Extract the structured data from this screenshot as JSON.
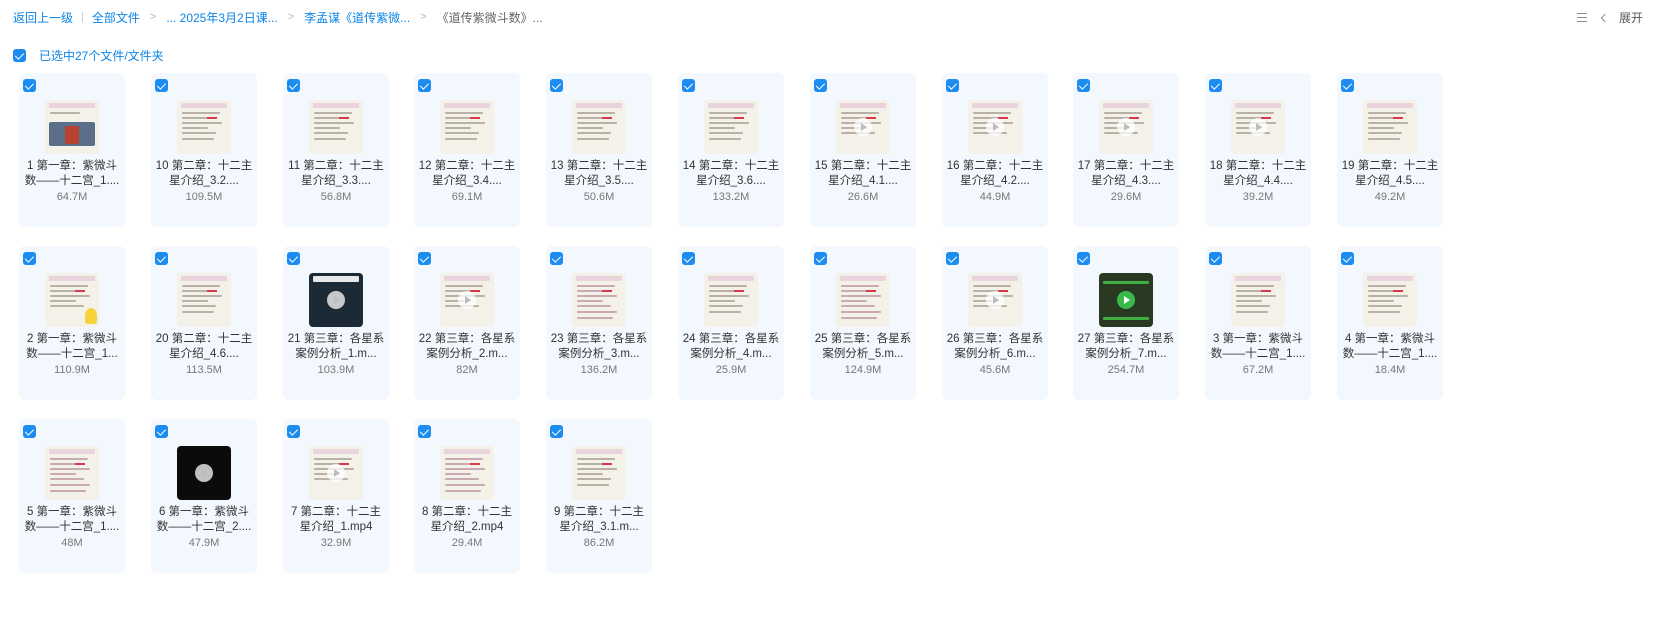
{
  "breadcrumb": {
    "back": "返回上一级",
    "all_files": "全部文件",
    "path1": "... 2025年3月2日课...",
    "path2": "李孟谋《道传紫微...",
    "current": "《道传紫微斗数》..."
  },
  "toolbar": {
    "expand": "展开"
  },
  "selection": {
    "label": "已选中27个文件/文件夹"
  },
  "files": [
    {
      "name": "1 第一章：紫微斗数——十二宫_1....",
      "size": "64.7M",
      "thumb": "photo"
    },
    {
      "name": "10 第二章：十二主星介绍_3.2....",
      "size": "109.5M",
      "thumb": "slide"
    },
    {
      "name": "11 第二章：十二主星介绍_3.3....",
      "size": "56.8M",
      "thumb": "slide"
    },
    {
      "name": "12 第二章：十二主星介绍_3.4....",
      "size": "69.1M",
      "thumb": "slide"
    },
    {
      "name": "13 第二章：十二主星介绍_3.5....",
      "size": "50.6M",
      "thumb": "slide"
    },
    {
      "name": "14 第二章：十二主星介绍_3.6....",
      "size": "133.2M",
      "thumb": "slide"
    },
    {
      "name": "15 第二章：十二主星介绍_4.1....",
      "size": "26.6M",
      "thumb": "slide-play"
    },
    {
      "name": "16 第二章：十二主星介绍_4.2....",
      "size": "44.9M",
      "thumb": "slide-play"
    },
    {
      "name": "17 第二章：十二主星介绍_4.3....",
      "size": "29.6M",
      "thumb": "slide-play"
    },
    {
      "name": "18 第二章：十二主星介绍_4.4....",
      "size": "39.2M",
      "thumb": "slide-play"
    },
    {
      "name": "19 第二章：十二主星介绍_4.5....",
      "size": "49.2M",
      "thumb": "slide"
    },
    {
      "name": "2 第一章：紫微斗数——十二宫_1...",
      "size": "110.9M",
      "thumb": "mascot"
    },
    {
      "name": "20 第二章：十二主星介绍_4.6....",
      "size": "113.5M",
      "thumb": "slide"
    },
    {
      "name": "21 第三章：各星系案例分析_1.m...",
      "size": "103.9M",
      "thumb": "stage"
    },
    {
      "name": "22 第三章：各星系案例分析_2.m...",
      "size": "82M",
      "thumb": "slide-play"
    },
    {
      "name": "23 第三章：各星系案例分析_3.m...",
      "size": "136.2M",
      "thumb": "table"
    },
    {
      "name": "24 第三章：各星系案例分析_4.m...",
      "size": "25.9M",
      "thumb": "slide"
    },
    {
      "name": "25 第三章：各星系案例分析_5.m...",
      "size": "124.9M",
      "thumb": "table"
    },
    {
      "name": "26 第三章：各星系案例分析_6.m...",
      "size": "45.6M",
      "thumb": "slide-play"
    },
    {
      "name": "27 第三章：各星系案例分析_7.m...",
      "size": "254.7M",
      "thumb": "green"
    },
    {
      "name": "3 第一章：紫微斗数——十二宫_1....",
      "size": "67.2M",
      "thumb": "slide"
    },
    {
      "name": "4 第一章：紫微斗数——十二宫_1....",
      "size": "18.4M",
      "thumb": "slide"
    },
    {
      "name": "5 第一章：紫微斗数——十二宫_1....",
      "size": "48M",
      "thumb": "table"
    },
    {
      "name": "6 第一章：紫微斗数——十二宫_2....",
      "size": "47.9M",
      "thumb": "dark"
    },
    {
      "name": "7 第二章：十二主星介绍_1.mp4",
      "size": "32.9M",
      "thumb": "slide-play"
    },
    {
      "name": "8 第二章：十二主星介绍_2.mp4",
      "size": "29.4M",
      "thumb": "table"
    },
    {
      "name": "9 第二章：十二主星介绍_3.1.m...",
      "size": "86.2M",
      "thumb": "slide"
    }
  ],
  "colors": {
    "accent": "#1c8cf0",
    "link": "#0b84e6",
    "card_bg": "#f2f8fe"
  },
  "icons": [
    "checkbox-checked-icon",
    "list-view-icon",
    "chevron-left-icon",
    "play-icon"
  ]
}
